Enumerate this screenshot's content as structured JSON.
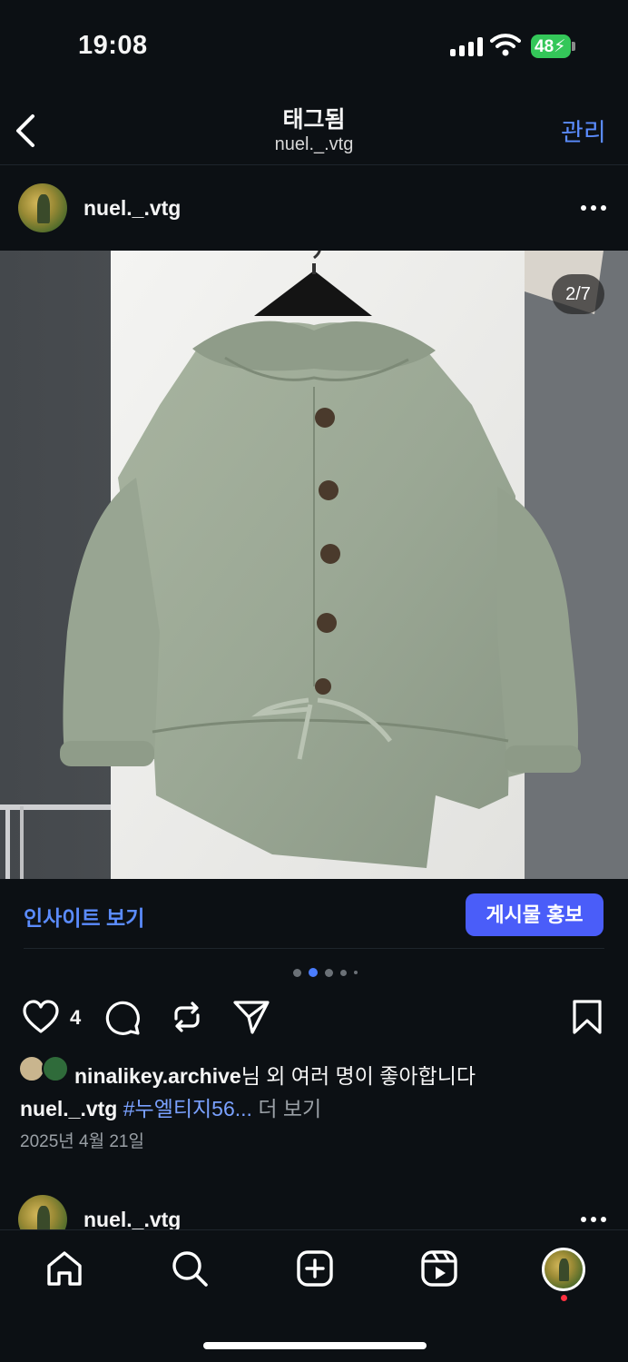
{
  "status_bar": {
    "time": "19:08",
    "battery": "48",
    "icons": [
      "signal-icon",
      "wifi-icon",
      "battery-charging-icon"
    ]
  },
  "header": {
    "title": "태그됨",
    "subtitle": "nuel._.vtg",
    "action_label": "관리",
    "back_icon": "chevron-left-icon"
  },
  "post": {
    "username": "nuel._.vtg",
    "image_counter": "2/7",
    "insight_label": "인사이트 보기",
    "promote_label": "게시물 홍보",
    "carousel": {
      "count": 5,
      "active_index": 1
    },
    "like_count": "4",
    "liked_by_user": "ninalikey.archive",
    "liked_by_suffix": "님 외 여러 명이 좋아합니다",
    "caption_user": "nuel._.vtg",
    "caption_tag": "#누엘티지56...",
    "caption_more": "더 보기",
    "date": "2025년 4월 21일"
  },
  "next_post": {
    "username": "nuel._.vtg"
  },
  "nav": {
    "items": [
      "home-icon",
      "search-icon",
      "create-icon",
      "reels-icon",
      "profile-avatar"
    ]
  },
  "colors": {
    "background": "#0c1014",
    "accent_link": "#5b8cff",
    "promote_button": "#4a5df9",
    "battery": "#34c759",
    "notification_dot": "#ff3040"
  }
}
